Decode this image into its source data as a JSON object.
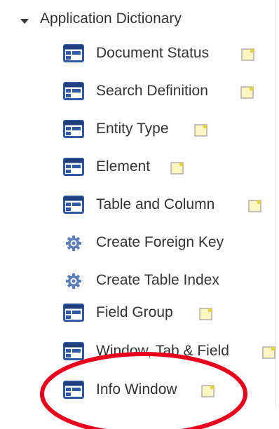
{
  "tree": {
    "parent": {
      "label": "Application Dictionary",
      "expanded": true,
      "icon": "caret-down-icon"
    },
    "items": [
      {
        "label": "Document Status",
        "icon": "window-icon",
        "favorite": true
      },
      {
        "label": "Search Definition",
        "icon": "window-icon",
        "favorite": true
      },
      {
        "label": "Entity Type",
        "icon": "window-icon",
        "favorite": true
      },
      {
        "label": "Element",
        "icon": "window-icon",
        "favorite": true
      },
      {
        "label": "Table and Column",
        "icon": "window-icon",
        "favorite": true
      },
      {
        "label": "Create Foreign Key",
        "icon": "process-gear-icon",
        "favorite": false
      },
      {
        "label": "Create Table Index",
        "icon": "process-gear-icon",
        "favorite": false
      },
      {
        "label": "Field Group",
        "icon": "window-icon",
        "favorite": true
      },
      {
        "label": "Window, Tab & Field",
        "icon": "window-icon",
        "favorite": true
      },
      {
        "label": "Info Window",
        "icon": "window-icon",
        "favorite": true
      }
    ]
  },
  "colors": {
    "text": "#333333",
    "window_icon_blue": "#2f5aa8",
    "window_icon_dark": "#1f3f7c",
    "gear_blue": "#5a7fb9",
    "favorite_fill": "#fdf6c3",
    "favorite_border": "#9c9c9c",
    "annotation_red": "#e8001c"
  },
  "annotation": {
    "shape": "ellipse",
    "highlights": "Info Window"
  }
}
